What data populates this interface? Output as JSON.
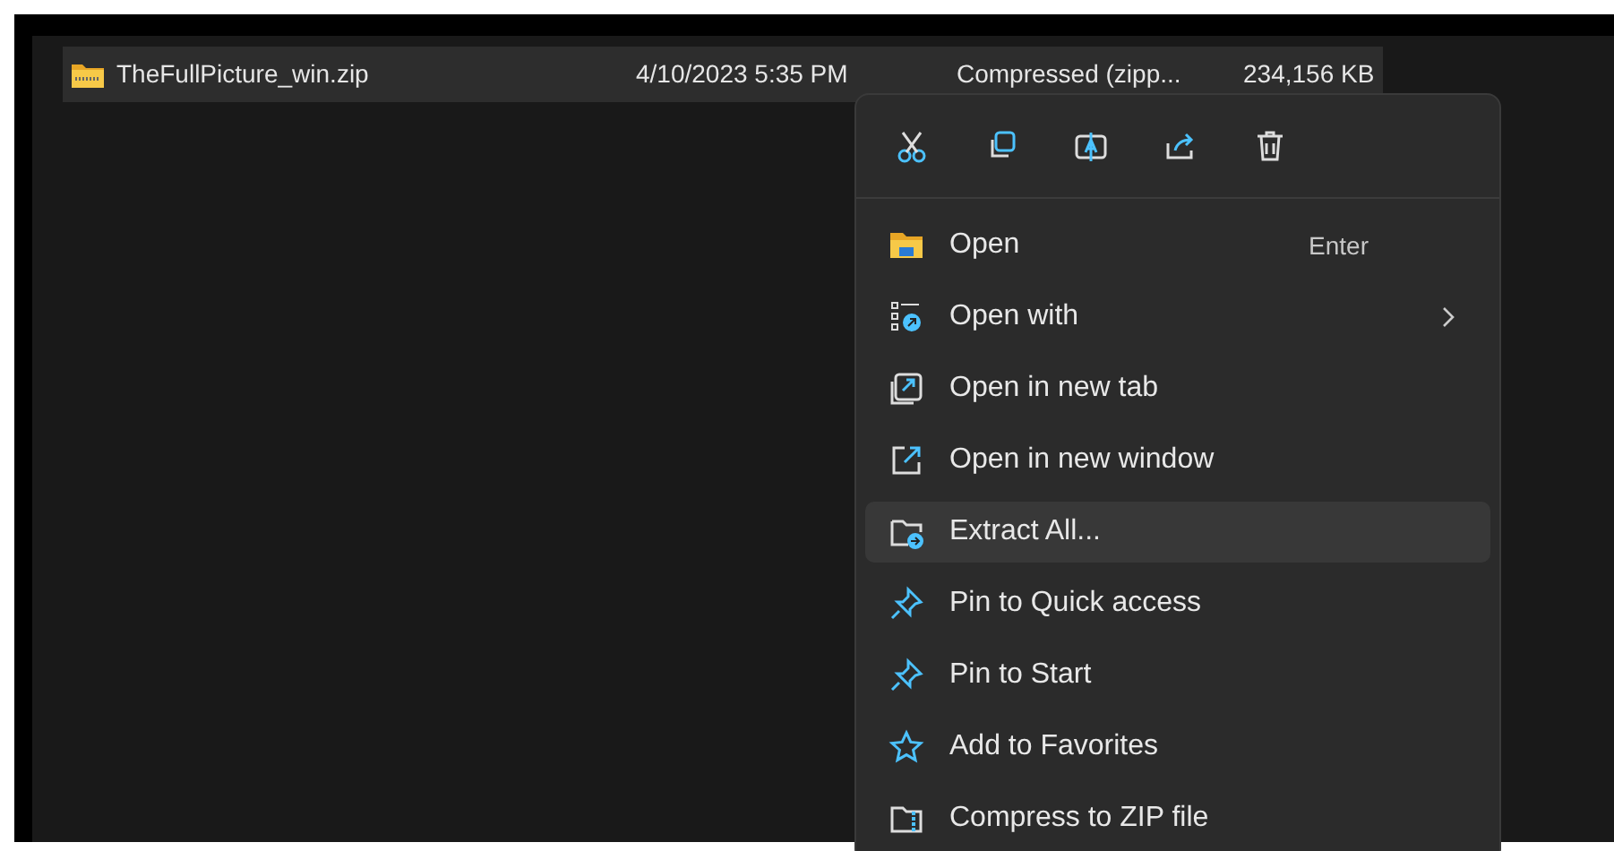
{
  "file_row": {
    "name": "TheFullPicture_win.zip",
    "date": "4/10/2023 5:35 PM",
    "type": "Compressed (zipp...",
    "size": "234,156 KB",
    "selected": true
  },
  "context_menu": {
    "items": [
      {
        "label": "Open",
        "shortcut": "Enter",
        "submenu": false,
        "selected": false
      },
      {
        "label": "Open with",
        "submenu": true,
        "selected": false
      },
      {
        "label": "Open in new tab",
        "submenu": false,
        "selected": false
      },
      {
        "label": "Open in new window",
        "submenu": false,
        "selected": false
      },
      {
        "label": "Extract All...",
        "submenu": false,
        "selected": true
      },
      {
        "label": "Pin to Quick access",
        "submenu": false,
        "selected": false
      },
      {
        "label": "Pin to Start",
        "submenu": false,
        "selected": false
      },
      {
        "label": "Add to Favorites",
        "submenu": false,
        "selected": false
      },
      {
        "label": "Compress to ZIP file",
        "submenu": false,
        "selected": false
      }
    ]
  }
}
